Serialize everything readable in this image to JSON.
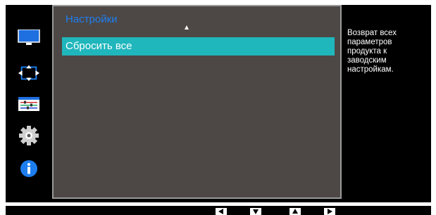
{
  "sidebar": {
    "icons": [
      "monitor-icon",
      "size-position-icon",
      "settings-sliders-icon",
      "gear-icon",
      "info-icon"
    ]
  },
  "menu": {
    "title": "Настройки",
    "items": [
      {
        "label": "Сбросить все",
        "selected": true
      }
    ]
  },
  "help_text": "Возврат всех параметров продукта к заводским настройкам.",
  "nav_buttons": [
    "left-button",
    "down-button",
    "up-button",
    "right-button"
  ],
  "colors": {
    "title": "#1e7ef0",
    "selection": "#1fb6bc",
    "panel_bg": "#4d4846",
    "panel_border": "#9a9a9a",
    "background": "#000000"
  }
}
